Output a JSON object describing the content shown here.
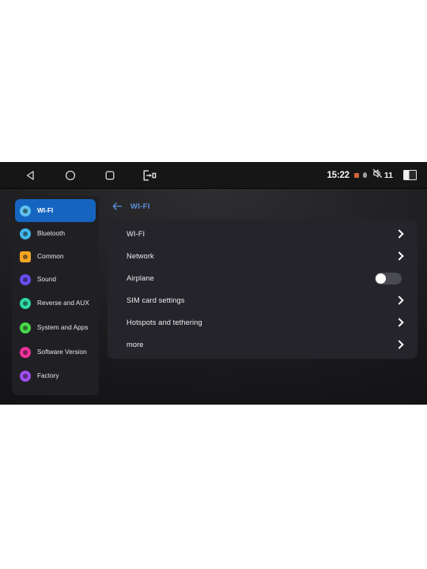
{
  "statusbar": {
    "nav": [
      {
        "name": "back-button",
        "icon": "triangle-left-icon"
      },
      {
        "name": "home-button",
        "icon": "circle-icon"
      },
      {
        "name": "recents-button",
        "icon": "square-icon"
      },
      {
        "name": "split-screen-button",
        "icon": "exit-box-arrow-icon"
      }
    ],
    "time": "15:22",
    "volume_level": "11",
    "icons": {
      "alert": "orange-square-icon",
      "location": "location-pin-icon",
      "volume": "volume-muted-icon",
      "battery": "battery-half-icon"
    }
  },
  "sidebar": {
    "items": [
      {
        "label": "WI-FI",
        "icon": "wifi-icon",
        "color": "#5ec1ef",
        "selected": true,
        "shape": "circle"
      },
      {
        "label": "Bluetooth",
        "icon": "bluetooth-icon",
        "color": "#3fb6e8",
        "selected": false,
        "shape": "circle"
      },
      {
        "label": "Common",
        "icon": "gear-icon",
        "color": "#f5a623",
        "selected": false,
        "shape": "square"
      },
      {
        "label": "Sound",
        "icon": "speaker-icon",
        "color": "#6a4cf0",
        "selected": false,
        "shape": "circle"
      },
      {
        "label": "Reverse and AUX",
        "icon": "reverse-icon",
        "color": "#2fd9a4",
        "selected": false,
        "shape": "circle"
      },
      {
        "label": "System and Apps",
        "icon": "apps-icon",
        "color": "#49d94a",
        "selected": false,
        "shape": "circle"
      },
      {
        "label": "Software Version",
        "icon": "info-icon",
        "color": "#f0309b",
        "selected": false,
        "shape": "circle"
      },
      {
        "label": "Factory",
        "icon": "power-icon",
        "color": "#a24cf0",
        "selected": false,
        "shape": "circle"
      }
    ]
  },
  "pane": {
    "back_icon": "arrow-left-icon",
    "title": "WI-FI",
    "title_color": "#5e8fe0",
    "rows": [
      {
        "label": "WI-FI",
        "control": "chevron"
      },
      {
        "label": "Network",
        "control": "chevron"
      },
      {
        "label": "Airplane",
        "control": "toggle",
        "toggle_state": "off"
      },
      {
        "label": "SIM card settings",
        "control": "chevron"
      },
      {
        "label": "Hotspots and tethering",
        "control": "chevron"
      },
      {
        "label": "more",
        "control": "chevron"
      }
    ]
  }
}
